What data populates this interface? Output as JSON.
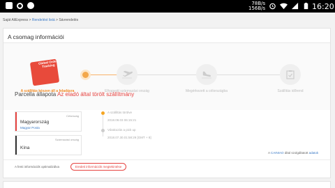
{
  "status_bar": {
    "speed_top": "78B/s",
    "speed_bottom": "156B/s",
    "time": "16:20",
    "icons": [
      "photo-icon",
      "instagram-icon",
      "sync-icon",
      "alarm-icon",
      "wifi-icon",
      "signal-icon",
      "battery-icon"
    ]
  },
  "breadcrumb": {
    "home": "Saját AliExpress",
    "sep1": ">",
    "orders": "Rendelést listá",
    "sep2": ">",
    "current": "Sávrendelés"
  },
  "card": {
    "title": "A csomag információi"
  },
  "badge": {
    "text": "Global Order Tracking"
  },
  "steps": [
    {
      "label": "A szállítás készen áll a feladásra",
      "active": true
    },
    {
      "label": "Elhagyott származási ország",
      "active": false
    },
    {
      "label": "Megérkezett a célországba",
      "active": false
    },
    {
      "label": "Szállítás időrend",
      "active": false
    }
  ],
  "parcel": {
    "prefix": "Parcella állapota",
    "status": "Az eladó által törölt szállítmány"
  },
  "destination": {
    "caption": "Célország",
    "country": "Magyarország",
    "carrier": "Magyar Posta"
  },
  "origin": {
    "caption": "Származási ország",
    "country": "Kína"
  },
  "timeline": [
    {
      "title": "A szállítás törölve",
      "time": "2018.08.03 06:15:21"
    },
    {
      "title": "Várakozás a pick up",
      "time": "2018.07.30.01:58:29 [GMT + 8]"
    }
  ],
  "provider": {
    "prefix": "A",
    "name": "CAINIAO",
    "middle": "által szolgáltatott",
    "suffix": "adatok"
  },
  "footer": {
    "note": "A fenti információk optimalizálva",
    "button": "Eredeti információk megtekintése"
  },
  "colors": {
    "accent_orange": "#f08a23",
    "accent_red": "#e64340",
    "link_blue": "#3a79c5"
  }
}
